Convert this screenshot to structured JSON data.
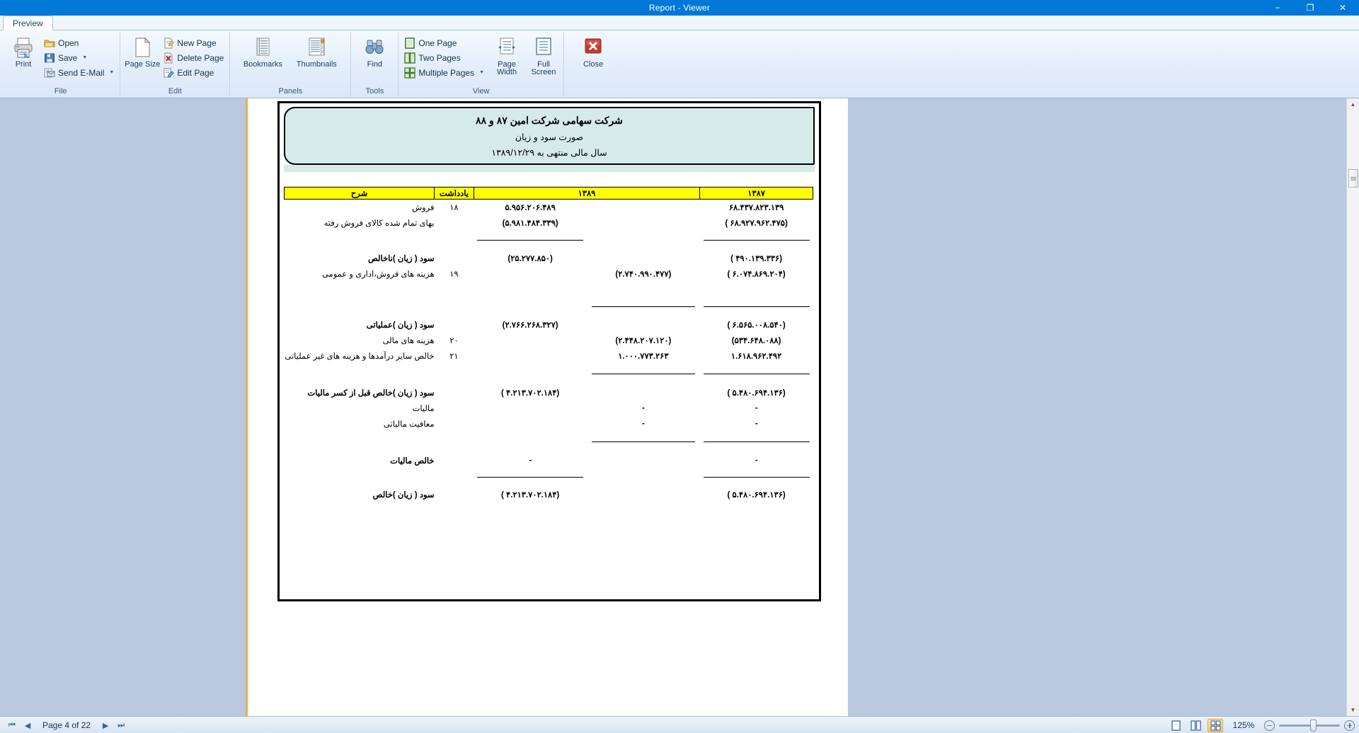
{
  "window": {
    "title": "Report - Viewer",
    "minimize": "−",
    "maximize": "❐",
    "close": "✕"
  },
  "ribbon": {
    "tabs": [
      {
        "label": "Preview"
      }
    ],
    "groups": [
      {
        "name": "File",
        "label": "File",
        "big": {
          "label": "Print",
          "icon": "printer-icon"
        },
        "items": [
          {
            "label": "Open",
            "icon": "open-folder-icon",
            "dropdown": false
          },
          {
            "label": "Save",
            "icon": "save-disk-icon",
            "dropdown": true
          },
          {
            "label": "Send E-Mail",
            "icon": "email-icon",
            "dropdown": true
          }
        ]
      },
      {
        "name": "Edit",
        "label": "Edit",
        "big": {
          "label": "Page Size",
          "icon": "page-size-icon"
        },
        "items": [
          {
            "label": "New Page",
            "icon": "new-page-icon",
            "dropdown": false
          },
          {
            "label": "Delete Page",
            "icon": "delete-page-icon",
            "dropdown": false
          },
          {
            "label": "Edit Page",
            "icon": "edit-page-icon",
            "dropdown": false
          }
        ]
      },
      {
        "name": "Panels",
        "label": "Panels",
        "bigs": [
          {
            "label": "Bookmarks",
            "icon": "bookmarks-icon"
          },
          {
            "label": "Thumbnails",
            "icon": "thumbnails-icon"
          }
        ]
      },
      {
        "name": "Tools",
        "label": "Tools",
        "bigs": [
          {
            "label": "Find",
            "icon": "binoculars-icon"
          }
        ]
      },
      {
        "name": "View",
        "label": "View",
        "items": [
          {
            "label": "One Page",
            "icon": "one-page-icon",
            "dropdown": false
          },
          {
            "label": "Two Pages",
            "icon": "two-pages-icon",
            "dropdown": false
          },
          {
            "label": "Multiple Pages",
            "icon": "multiple-pages-icon",
            "dropdown": true
          }
        ],
        "bigs": [
          {
            "label": "Page Width",
            "icon": "page-width-icon"
          },
          {
            "label": "Full Screen",
            "icon": "full-screen-icon"
          }
        ]
      },
      {
        "name": "Close",
        "label": "",
        "bigs": [
          {
            "label": "Close",
            "icon": "close-x-icon"
          }
        ]
      }
    ]
  },
  "document": {
    "header": {
      "line1": "شرکت سهامی شرکت امین ۸۷ و ۸۸",
      "line2": "صورت سود و زیان",
      "line3": "سال مالی منتهی به ۱۳۸۹/۱۲/۲۹"
    },
    "columns": {
      "col_1387": "۱۳۸۷",
      "col_1389": "۱۳۸۹",
      "col_note": "یادداشت",
      "col_desc": "شرح"
    },
    "rows": [
      {
        "desc": "فروش",
        "bold": false,
        "note": "۱۸",
        "v1389a": "",
        "v1389b": "۵.۹۵۶.۲۰۶.۴۸۹",
        "v1387": "۶۸.۴۳۷.۸۲۳.۱۳۹"
      },
      {
        "desc": "بهای تمام شده کالای فروش رفته",
        "bold": false,
        "note": "",
        "v1389a": "",
        "v1389b": "(۵.۹۸۱.۴۸۴.۳۳۹)",
        "v1387": "(۶۸.۹۲۷.۹۶۲.۴۷۵ )"
      },
      {
        "desc": "سود ( زیان )ناخالص",
        "bold": true,
        "note": "",
        "v1389a": "",
        "v1389b": "(۲۵.۲۷۷.۸۵۰)",
        "v1387": "(۴۹۰.۱۳۹.۳۳۶ )"
      },
      {
        "desc": "هزینه های فروش،اداری و عمومی",
        "bold": false,
        "note": "۱۹",
        "v1389a": "(۲.۷۴۰.۹۹۰.۴۷۷)",
        "v1389b": "",
        "v1387": "(۶.۰۷۴.۸۶۹.۲۰۴ )"
      },
      {
        "desc": "سود ( زیان )عملیاتی",
        "bold": true,
        "note": "",
        "v1389a": "",
        "v1389b": "(۲.۷۶۶.۲۶۸.۳۲۷)",
        "v1387": "(۶.۵۶۵.۰۰۸.۵۴۰ )"
      },
      {
        "desc": "هزینه های مالی",
        "bold": false,
        "note": "۲۰",
        "v1389a": "(۲.۴۴۸.۲۰۷.۱۲۰)",
        "v1389b": "",
        "v1387": "(۵۳۴.۶۴۸.۰۸۸)"
      },
      {
        "desc": "خالص سایر درآمدها و هزینه های غیر عملیاتی",
        "bold": false,
        "note": "۲۱",
        "v1389a": "۱.۰۰۰.۷۷۳.۲۶۳",
        "v1389b": "",
        "v1387": "۱.۶۱۸.۹۶۲.۴۹۲"
      },
      {
        "desc": "سود ( زیان )خالص قبل از کسر مالیات",
        "bold": true,
        "note": "",
        "v1389a": "",
        "v1389b": "(۴.۲۱۳.۷۰۲.۱۸۴ )",
        "v1387": "(۵.۴۸۰.۶۹۴.۱۳۶ )"
      },
      {
        "desc": "مالیات",
        "bold": false,
        "note": "",
        "v1389a": "-",
        "v1389b": "",
        "v1387": "-"
      },
      {
        "desc": "معافیت مالیاتی",
        "bold": false,
        "note": "",
        "v1389a": "-",
        "v1389b": "",
        "v1387": "-"
      },
      {
        "desc": "خالص مالیات",
        "bold": true,
        "note": "",
        "v1389a": "",
        "v1389b": "-",
        "v1387": "-"
      },
      {
        "desc": "سود ( زیان )خالص",
        "bold": true,
        "note": "",
        "v1389a": "",
        "v1389b": "(۴.۲۱۳.۷۰۲.۱۸۴ )",
        "v1387": "(۵.۴۸۰.۶۹۴.۱۳۶ )"
      }
    ]
  },
  "statusbar": {
    "first": "⏮",
    "prev": "◀",
    "page_label": "Page 4 of 22",
    "next": "▶",
    "last": "⏭",
    "zoom_label": "125%",
    "view_one_page": "one-page-view",
    "view_two_page": "two-page-view",
    "view_multi_page": "multi-page-view"
  },
  "colors": {
    "titlebar": "#0078D7",
    "header_fill": "#d6eaea",
    "table_header": "#ffff00",
    "gutter": "#b9c9e0",
    "accent_orange": "#f0ad4e"
  }
}
